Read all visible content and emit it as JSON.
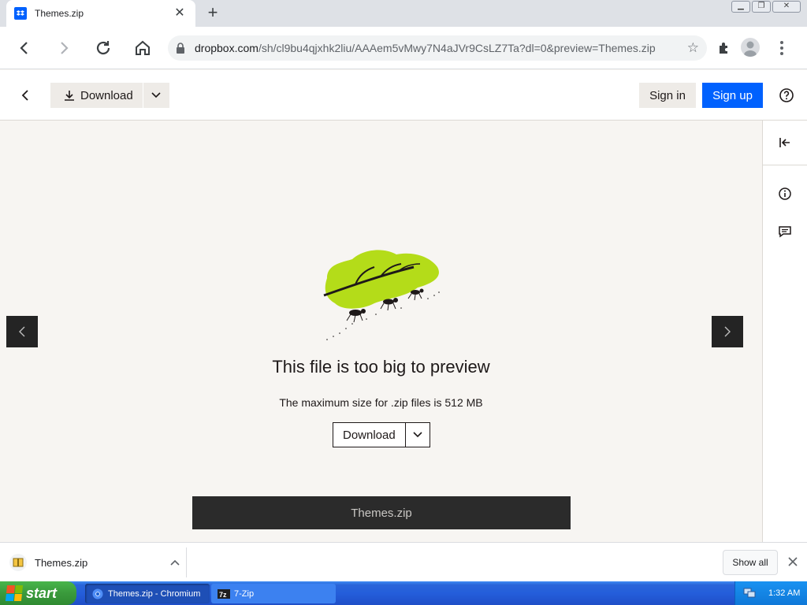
{
  "browser": {
    "tab_title": "Themes.zip",
    "url_host": "dropbox.com",
    "url_path": "/sh/cl9bu4qjxhk2liu/AAAem5vMwy7N4aJVr9CsLZ7Ta?dl=0&preview=Themes.zip"
  },
  "header": {
    "download_label": "Download",
    "signin_label": "Sign in",
    "signup_label": "Sign up"
  },
  "preview": {
    "heading": "This file is too big to preview",
    "message": "The maximum size for .zip files is 512 MB",
    "download_label": "Download",
    "filename": "Themes.zip"
  },
  "download_shelf": {
    "item_name": "Themes.zip",
    "show_all_label": "Show all"
  },
  "taskbar": {
    "start_label": "start",
    "tasks": [
      {
        "label": "Themes.zip - Chromium"
      },
      {
        "label": "7-Zip"
      }
    ],
    "clock": "1:32 AM"
  },
  "colors": {
    "dropbox_blue": "#0061fe",
    "leaf_green": "#b4dc19",
    "preview_bg": "#f7f5f2",
    "dark_bar": "#2b2b2b"
  }
}
